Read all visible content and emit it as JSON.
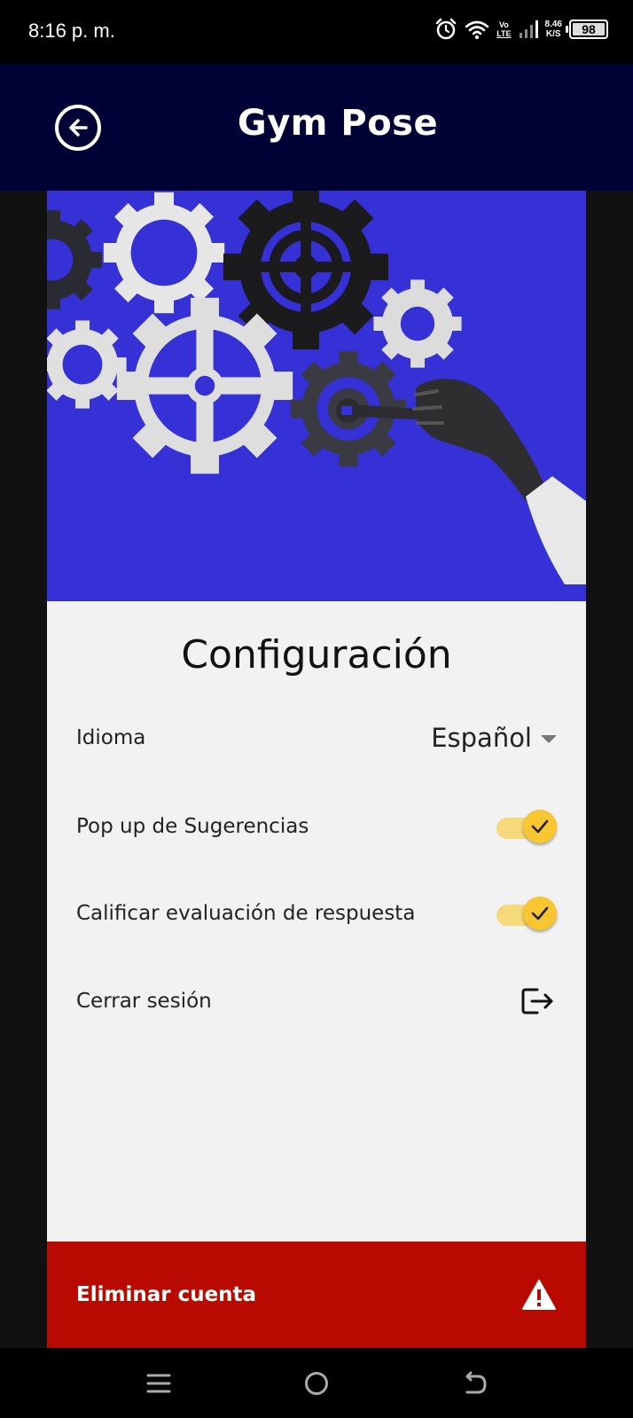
{
  "status_bar": {
    "time": "8:16 p. m.",
    "volte_top": "Vo",
    "volte_bottom": "LTE",
    "net_speed_value": "8.46",
    "net_speed_unit": "K/S",
    "battery": "98",
    "icons": [
      "alarm-icon",
      "wifi-icon",
      "signal-icon",
      "battery-icon"
    ]
  },
  "app_bar": {
    "title": "Gym Pose",
    "back_icon": "arrow-left-circle-icon"
  },
  "settings": {
    "title": "Configuración",
    "language": {
      "label": "Idioma",
      "value": "Español"
    },
    "popup_suggestions": {
      "label": "Pop up de Sugerencias",
      "enabled": true
    },
    "rate_evaluation": {
      "label": "Calificar evaluación de respuesta",
      "enabled": true
    },
    "logout": {
      "label": "Cerrar sesión",
      "icon": "logout-icon"
    },
    "delete_account": {
      "label": "Eliminar cuenta",
      "icon": "warning-icon"
    }
  },
  "colors": {
    "app_bar": "#000235",
    "hero_background": "#3531d6",
    "toggle_on": "#f7c631",
    "danger": "#b90a00"
  },
  "nav_bar": {
    "icons": [
      "menu-icon",
      "home-circle-icon",
      "back-arrow-icon"
    ]
  }
}
